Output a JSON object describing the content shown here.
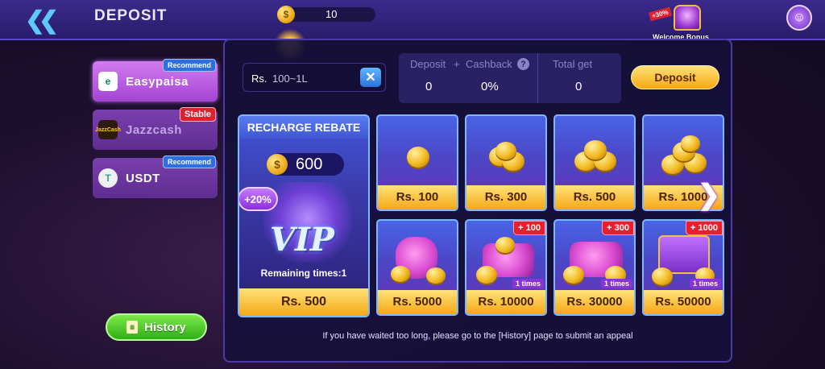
{
  "header": {
    "title": "DEPOSIT",
    "balance": "10",
    "welcome_tag": "+30%",
    "welcome_label": "Welcome Bonus"
  },
  "methods": [
    {
      "label": "Easypaisa",
      "badge": "Recommend",
      "icon": "e",
      "active": true
    },
    {
      "label": "Jazzcash",
      "badge": "Stable",
      "icon": "JazzCash",
      "active": false
    },
    {
      "label": "USDT",
      "badge": "Recommend",
      "icon": "T",
      "active": false
    }
  ],
  "history_label": "History",
  "input": {
    "prefix": "Rs.",
    "placeholder": "100~1L",
    "clear_icon": "close-icon"
  },
  "summary": {
    "deposit_label": "Deposit",
    "plus": "+",
    "cashback_label": "Cashback",
    "help": "?",
    "total_label": "Total get",
    "deposit_value": "0",
    "cashback_value": "0%",
    "total_value": "0"
  },
  "deposit_button": "Deposit",
  "rebate": {
    "title": "RECHARGE REBATE",
    "coins": "600",
    "percent": "+20%",
    "vip": "VIP",
    "remaining": "Remaining times:1",
    "price": "Rs. 500"
  },
  "tiles": [
    {
      "price": "Rs. 100",
      "bonus": "",
      "times": ""
    },
    {
      "price": "Rs. 300",
      "bonus": "",
      "times": ""
    },
    {
      "price": "Rs. 500",
      "bonus": "",
      "times": ""
    },
    {
      "price": "Rs. 1000",
      "bonus": "",
      "times": ""
    },
    {
      "price": "Rs. 5000",
      "bonus": "",
      "times": ""
    },
    {
      "price": "Rs. 10000",
      "bonus": "+ 100",
      "times": "1 times"
    },
    {
      "price": "Rs. 30000",
      "bonus": "+ 300",
      "times": "1 times"
    },
    {
      "price": "Rs. 50000",
      "bonus": "+ 1000",
      "times": "1 times"
    }
  ],
  "notice": "If you have waited too long, please go to the [History] page to submit an appeal",
  "colors": {
    "accent_gold": "#f5a814",
    "panel": "#16103a",
    "green": "#2fae17"
  }
}
